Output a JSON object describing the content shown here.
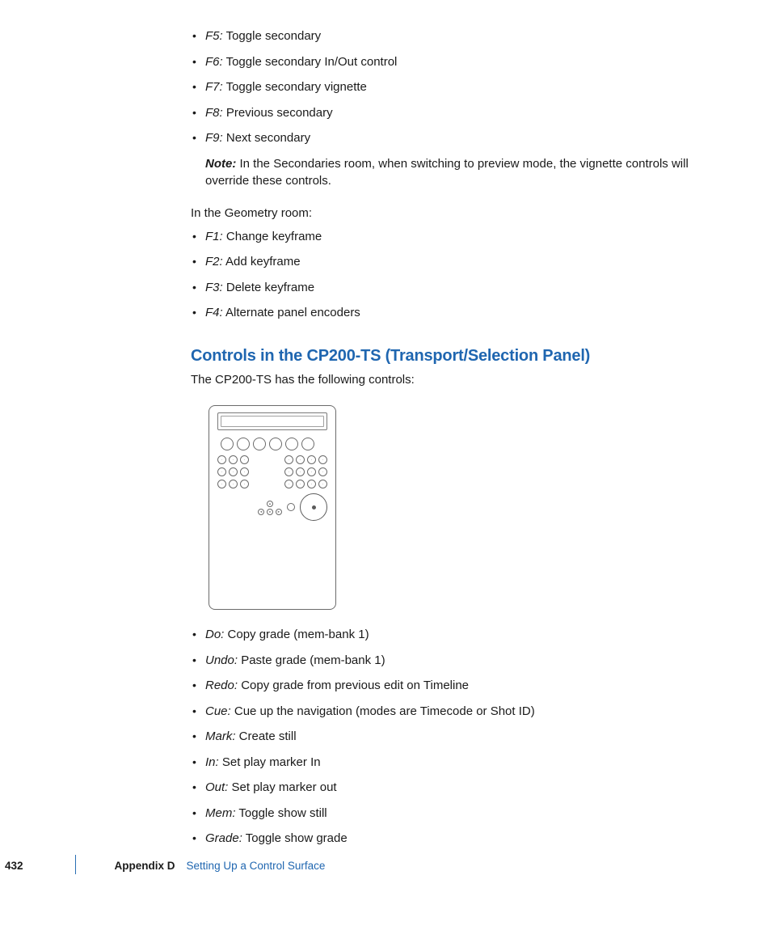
{
  "list1": [
    {
      "key": "F5:",
      "desc": "Toggle secondary"
    },
    {
      "key": "F6:",
      "desc": "Toggle secondary In/Out control"
    },
    {
      "key": "F7:",
      "desc": "Toggle secondary vignette"
    },
    {
      "key": "F8:",
      "desc": "Previous secondary"
    },
    {
      "key": "F9:",
      "desc": "Next secondary"
    }
  ],
  "note": {
    "label": "Note:",
    "text": "In the Secondaries room, when switching to preview mode, the vignette controls will override these controls."
  },
  "geometry_intro": "In the Geometry room:",
  "list2": [
    {
      "key": "F1:",
      "desc": "Change keyframe"
    },
    {
      "key": "F2:",
      "desc": "Add keyframe"
    },
    {
      "key": "F3:",
      "desc": "Delete keyframe"
    },
    {
      "key": "F4:",
      "desc": "Alternate panel encoders"
    }
  ],
  "heading": "Controls in the CP200-TS (Transport/Selection Panel)",
  "intro": "The CP200-TS has the following controls:",
  "list3": [
    {
      "key": "Do:",
      "desc": "Copy grade (mem-bank 1)"
    },
    {
      "key": "Undo:",
      "desc": "Paste grade (mem-bank 1)"
    },
    {
      "key": "Redo:",
      "desc": "Copy grade from previous edit on Timeline"
    },
    {
      "key": "Cue:",
      "desc": "Cue up the navigation (modes are Timecode or Shot ID)"
    },
    {
      "key": "Mark:",
      "desc": "Create still"
    },
    {
      "key": "In:",
      "desc": "Set play marker In"
    },
    {
      "key": "Out:",
      "desc": "Set play marker out"
    },
    {
      "key": "Mem:",
      "desc": "Toggle show still"
    },
    {
      "key": "Grade:",
      "desc": "Toggle show grade"
    }
  ],
  "footer": {
    "page": "432",
    "appendix": "Appendix D",
    "title": "Setting Up a Control Surface"
  }
}
